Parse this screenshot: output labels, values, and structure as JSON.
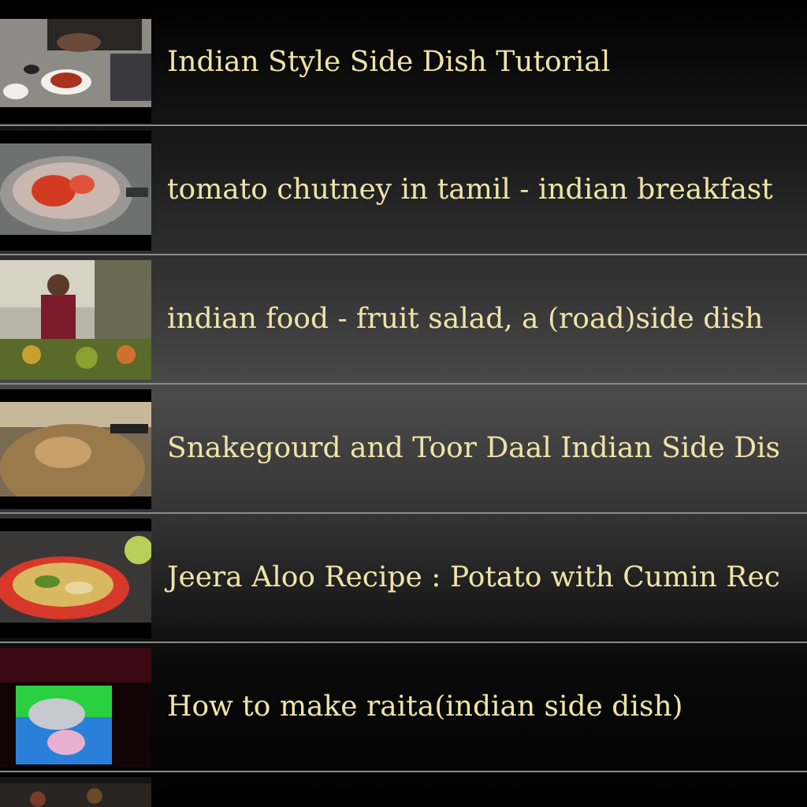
{
  "videos": [
    {
      "title": "Indian Style Side Dish Tutorial",
      "thumbnail": {
        "kind": "picture"
      }
    },
    {
      "title": "tomato chutney in tamil - indian breakfast",
      "thumbnail": {
        "kind": "picture"
      }
    },
    {
      "title": "indian food - fruit salad, a (road)side dish",
      "thumbnail": {
        "kind": "picture"
      }
    },
    {
      "title": "Snakegourd and Toor Daal Indian Side Dis",
      "thumbnail": {
        "kind": "picture"
      }
    },
    {
      "title": "Jeera Aloo Recipe : Potato with Cumin Rec",
      "thumbnail": {
        "kind": "picture"
      }
    },
    {
      "title": "How to make raita(indian side dish)",
      "thumbnail": {
        "kind": "picture"
      }
    },
    {
      "thumbnail": {
        "kind": "picture"
      }
    }
  ]
}
